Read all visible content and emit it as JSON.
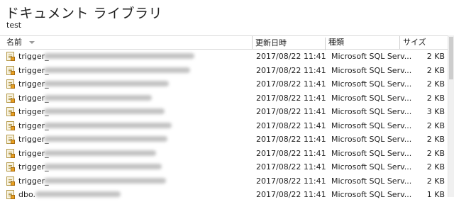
{
  "library": {
    "title": "ドキュメント ライブラリ",
    "subtitle": "test"
  },
  "columns": {
    "name": "名前",
    "modified": "更新日時",
    "type": "種類",
    "size": "サイズ"
  },
  "rows": [
    {
      "prefix": "trigger_",
      "modified": "2017/08/22 11:41",
      "type": "Microsoft SQL Serv...",
      "size": "2 KB"
    },
    {
      "prefix": "trigger_",
      "modified": "2017/08/22 11:41",
      "type": "Microsoft SQL Serv...",
      "size": "2 KB"
    },
    {
      "prefix": "trigger_",
      "modified": "2017/08/22 11:41",
      "type": "Microsoft SQL Serv...",
      "size": "2 KB"
    },
    {
      "prefix": "trigger_",
      "modified": "2017/08/22 11:41",
      "type": "Microsoft SQL Serv...",
      "size": "2 KB"
    },
    {
      "prefix": "trigger_",
      "modified": "2017/08/22 11:41",
      "type": "Microsoft SQL Serv...",
      "size": "3 KB"
    },
    {
      "prefix": "trigger_",
      "modified": "2017/08/22 11:41",
      "type": "Microsoft SQL Serv...",
      "size": "2 KB"
    },
    {
      "prefix": "trigger_",
      "modified": "2017/08/22 11:41",
      "type": "Microsoft SQL Serv...",
      "size": "2 KB"
    },
    {
      "prefix": "trigger_",
      "modified": "2017/08/22 11:41",
      "type": "Microsoft SQL Serv...",
      "size": "2 KB"
    },
    {
      "prefix": "trigger_",
      "modified": "2017/08/22 11:41",
      "type": "Microsoft SQL Serv...",
      "size": "2 KB"
    },
    {
      "prefix": "trigger_",
      "modified": "2017/08/22 11:41",
      "type": "Microsoft SQL Serv...",
      "size": "2 KB"
    },
    {
      "prefix": "dbo.",
      "modified": "2017/08/22 11:41",
      "type": "Microsoft SQL Serv...",
      "size": "1 KB"
    }
  ]
}
